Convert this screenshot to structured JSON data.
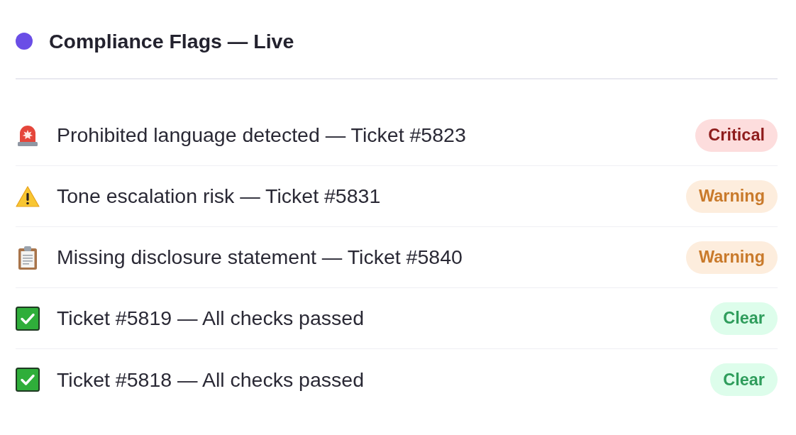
{
  "header": {
    "title": "Compliance Flags — Live"
  },
  "flags": [
    {
      "kind": "siren",
      "text": "Prohibited language detected — Ticket #5823",
      "badge": {
        "label": "Critical",
        "color": "#8e1c1c"
      }
    },
    {
      "kind": "warning",
      "text": "Tone escalation risk — Ticket #5831",
      "badge": {
        "label": "Warning",
        "color": "#c97a2b"
      }
    },
    {
      "kind": "clipboard",
      "text": "Missing disclosure statement — Ticket #5840",
      "badge": {
        "label": "Warning",
        "color": "#c97a2b"
      }
    },
    {
      "kind": "check",
      "text": "Ticket #5819 — All checks passed",
      "badge": {
        "label": "Clear",
        "color": "#2f9d5c"
      }
    },
    {
      "kind": "check",
      "text": "Ticket #5818 — All checks passed",
      "badge": {
        "label": "Clear",
        "color": "#2f9d5c"
      }
    }
  ]
}
